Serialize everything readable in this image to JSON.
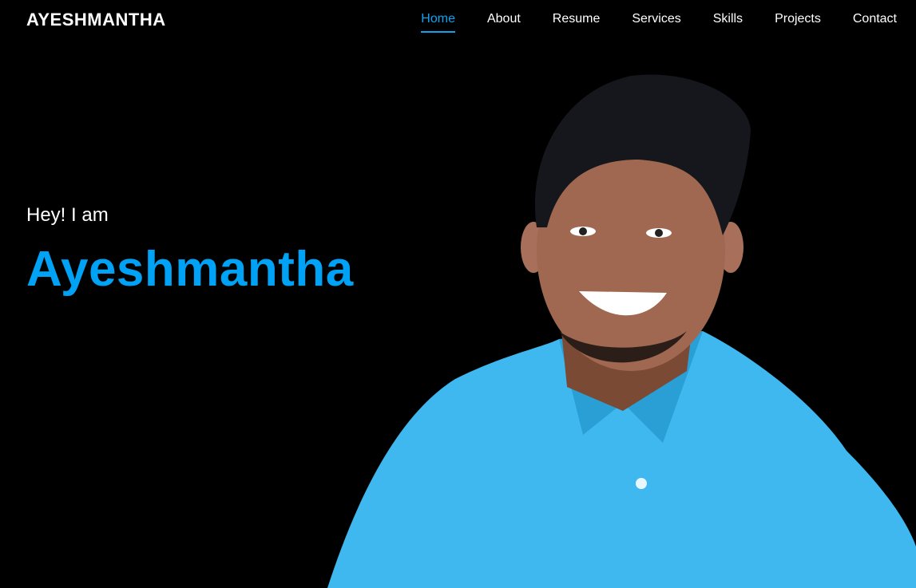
{
  "header": {
    "logo": "AYESHMANTHA",
    "nav": [
      {
        "label": "Home",
        "active": true
      },
      {
        "label": "About"
      },
      {
        "label": "Resume"
      },
      {
        "label": "Services"
      },
      {
        "label": "Skills"
      },
      {
        "label": "Projects"
      },
      {
        "label": "Contact"
      }
    ]
  },
  "hero": {
    "greeting": "Hey! I am",
    "name": "Ayeshmantha",
    "accent_color": "#00a2f5"
  }
}
